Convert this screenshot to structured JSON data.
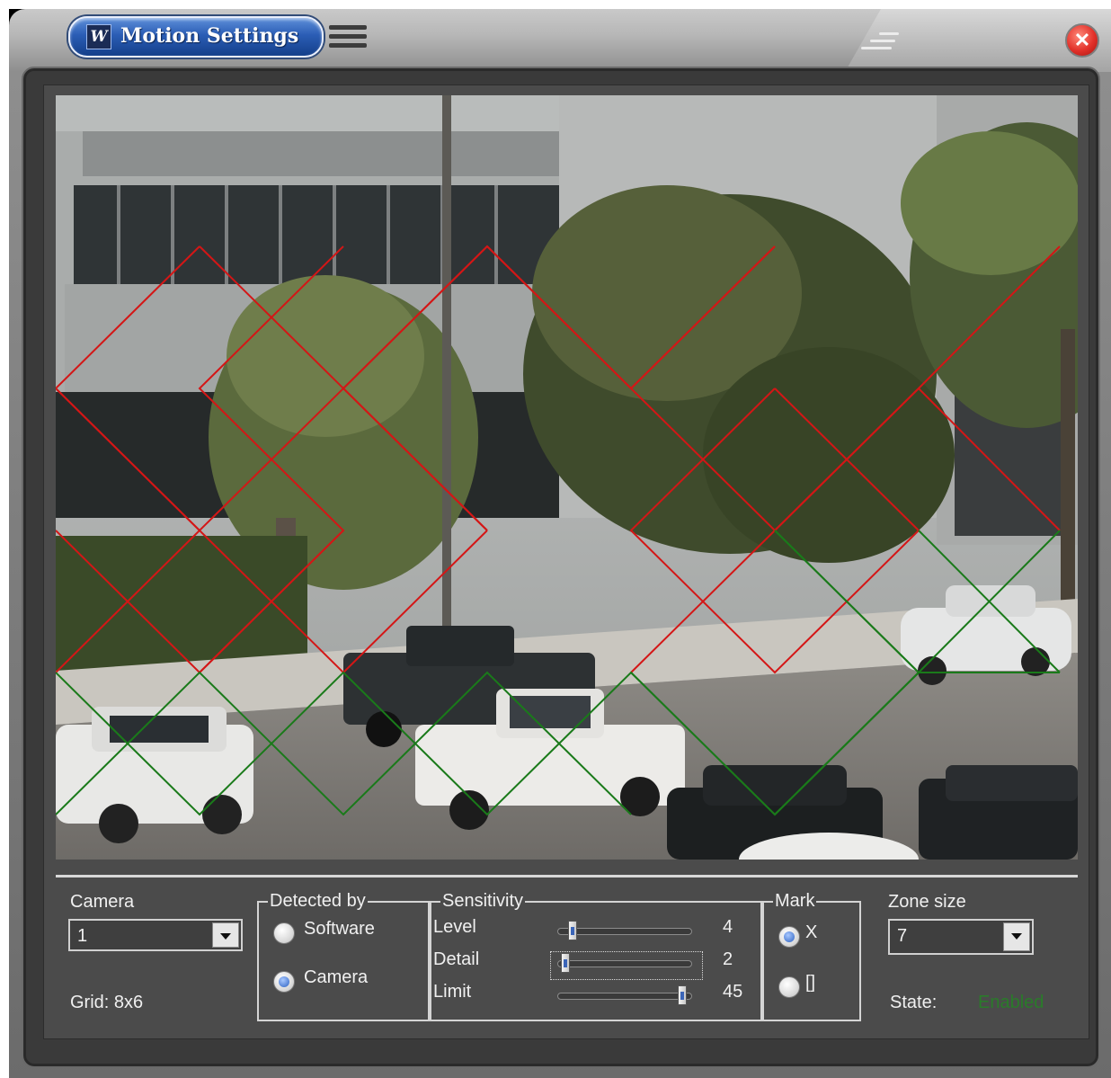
{
  "window": {
    "title": "Motion Settings",
    "logo_text": "W",
    "close_symbol": "✕"
  },
  "icons": {
    "logo": "app-logo-icon",
    "menu": "hamburger-menu-icon",
    "grip": "window-grip-icon",
    "close": "close-icon"
  },
  "colors": {
    "zone_active": "#d41616",
    "zone_inactive": "#1a7a1a",
    "state_enabled": "#2a7b2a",
    "title_accent": "#2b5db5"
  },
  "video": {
    "grid_note": "Diamond zone grid overlay"
  },
  "camera": {
    "label": "Camera",
    "value": "1",
    "grid_text": "Grid: 8x6"
  },
  "detected_by": {
    "title": "Detected by",
    "options": [
      {
        "label": "Software",
        "selected": false
      },
      {
        "label": "Camera",
        "selected": true
      }
    ]
  },
  "sensitivity": {
    "title": "Sensitivity",
    "rows": [
      {
        "label": "Level",
        "value": "4",
        "fraction": 0.1
      },
      {
        "label": "Detail",
        "value": "2",
        "fraction": 0.05
      },
      {
        "label": "Limit",
        "value": "45",
        "fraction": 0.9
      }
    ]
  },
  "mark": {
    "title": "Mark",
    "options": [
      {
        "label": "X",
        "selected": true
      },
      {
        "label": "[]",
        "selected": false
      }
    ]
  },
  "zone_size": {
    "label": "Zone size",
    "value": "7",
    "state_label": "State:",
    "state_value": "Enabled"
  }
}
